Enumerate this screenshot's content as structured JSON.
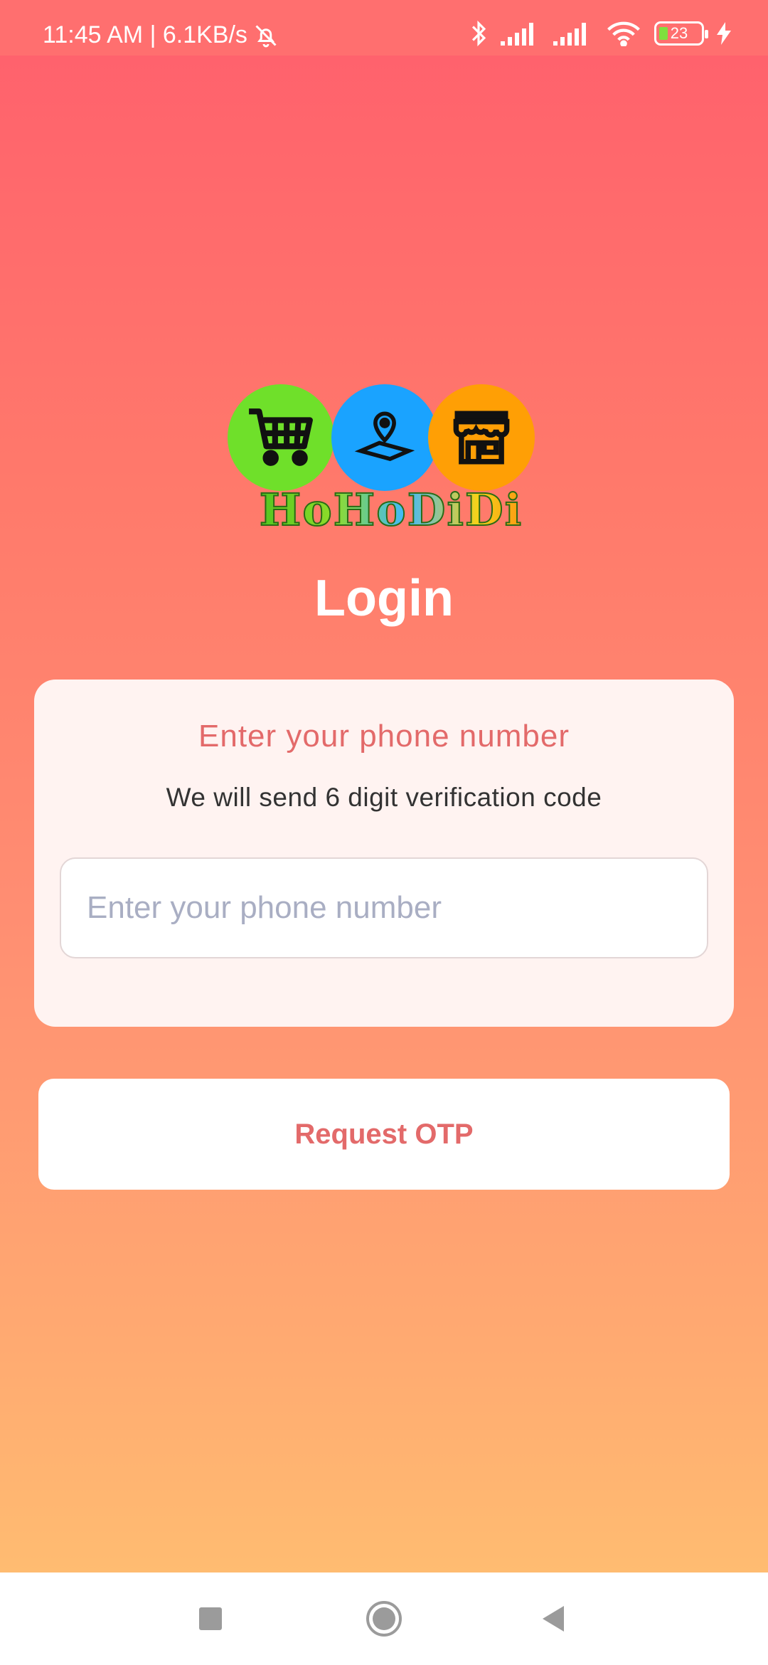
{
  "status_bar": {
    "time_speed": "11:45 AM | 6.1KB/s",
    "battery_level": "23",
    "icons": [
      "mute-bell-icon",
      "bluetooth-icon",
      "signal-icon",
      "signal-icon",
      "wifi-icon",
      "battery-icon",
      "charging-icon"
    ]
  },
  "logo": {
    "text": "HoHoDiDi",
    "icons": [
      "shopping-cart-icon",
      "location-pin-icon",
      "storefront-icon"
    ],
    "colors": [
      "#6fe02a",
      "#1aa3ff",
      "#ff9f05"
    ]
  },
  "page": {
    "title": "Login"
  },
  "card": {
    "heading": "Enter your phone number",
    "subtext": "We will send 6 digit verification code",
    "phone_placeholder": "Enter your phone number",
    "phone_value": ""
  },
  "actions": {
    "request_otp_label": "Request OTP"
  },
  "navigation": {
    "buttons": [
      "recent-apps",
      "home",
      "back"
    ]
  },
  "colors": {
    "gradient_top": "#ff5f6d",
    "gradient_bottom": "#ffc371",
    "accent": "#e36a6a",
    "card_bg": "#fff3f1"
  }
}
